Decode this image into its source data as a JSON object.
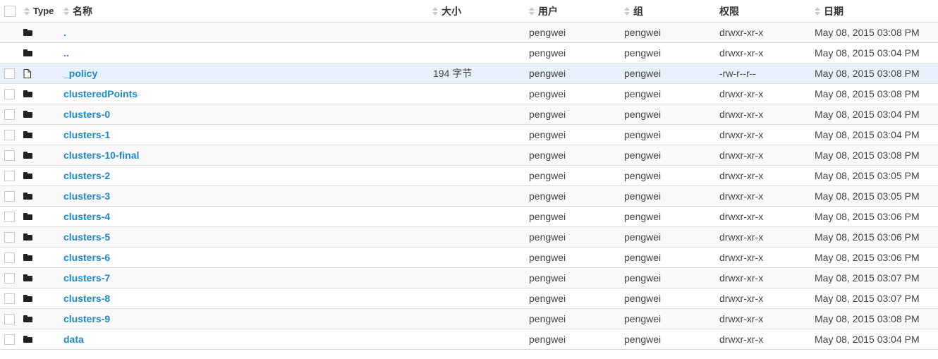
{
  "header": {
    "type": "Type",
    "name": "名称",
    "size": "大小",
    "user": "用户",
    "group": "组",
    "permission": "权限",
    "date": "日期"
  },
  "rows": [
    {
      "kind": "folder",
      "name": ".",
      "size": "",
      "user": "pengwei",
      "group": "pengwei",
      "permission": "drwxr-xr-x",
      "date": "May 08, 2015 03:08 PM",
      "has_checkbox": false
    },
    {
      "kind": "folder",
      "name": "..",
      "size": "",
      "user": "pengwei",
      "group": "pengwei",
      "permission": "drwxr-xr-x",
      "date": "May 08, 2015 03:04 PM",
      "has_checkbox": false
    },
    {
      "kind": "file",
      "name": "_policy",
      "size": "194 字节",
      "user": "pengwei",
      "group": "pengwei",
      "permission": "-rw-r--r--",
      "date": "May 08, 2015 03:08 PM",
      "has_checkbox": true
    },
    {
      "kind": "folder",
      "name": "clusteredPoints",
      "size": "",
      "user": "pengwei",
      "group": "pengwei",
      "permission": "drwxr-xr-x",
      "date": "May 08, 2015 03:08 PM",
      "has_checkbox": true
    },
    {
      "kind": "folder",
      "name": "clusters-0",
      "size": "",
      "user": "pengwei",
      "group": "pengwei",
      "permission": "drwxr-xr-x",
      "date": "May 08, 2015 03:04 PM",
      "has_checkbox": true
    },
    {
      "kind": "folder",
      "name": "clusters-1",
      "size": "",
      "user": "pengwei",
      "group": "pengwei",
      "permission": "drwxr-xr-x",
      "date": "May 08, 2015 03:04 PM",
      "has_checkbox": true
    },
    {
      "kind": "folder",
      "name": "clusters-10-final",
      "size": "",
      "user": "pengwei",
      "group": "pengwei",
      "permission": "drwxr-xr-x",
      "date": "May 08, 2015 03:08 PM",
      "has_checkbox": true
    },
    {
      "kind": "folder",
      "name": "clusters-2",
      "size": "",
      "user": "pengwei",
      "group": "pengwei",
      "permission": "drwxr-xr-x",
      "date": "May 08, 2015 03:05 PM",
      "has_checkbox": true
    },
    {
      "kind": "folder",
      "name": "clusters-3",
      "size": "",
      "user": "pengwei",
      "group": "pengwei",
      "permission": "drwxr-xr-x",
      "date": "May 08, 2015 03:05 PM",
      "has_checkbox": true
    },
    {
      "kind": "folder",
      "name": "clusters-4",
      "size": "",
      "user": "pengwei",
      "group": "pengwei",
      "permission": "drwxr-xr-x",
      "date": "May 08, 2015 03:06 PM",
      "has_checkbox": true
    },
    {
      "kind": "folder",
      "name": "clusters-5",
      "size": "",
      "user": "pengwei",
      "group": "pengwei",
      "permission": "drwxr-xr-x",
      "date": "May 08, 2015 03:06 PM",
      "has_checkbox": true
    },
    {
      "kind": "folder",
      "name": "clusters-6",
      "size": "",
      "user": "pengwei",
      "group": "pengwei",
      "permission": "drwxr-xr-x",
      "date": "May 08, 2015 03:06 PM",
      "has_checkbox": true
    },
    {
      "kind": "folder",
      "name": "clusters-7",
      "size": "",
      "user": "pengwei",
      "group": "pengwei",
      "permission": "drwxr-xr-x",
      "date": "May 08, 2015 03:07 PM",
      "has_checkbox": true
    },
    {
      "kind": "folder",
      "name": "clusters-8",
      "size": "",
      "user": "pengwei",
      "group": "pengwei",
      "permission": "drwxr-xr-x",
      "date": "May 08, 2015 03:07 PM",
      "has_checkbox": true
    },
    {
      "kind": "folder",
      "name": "clusters-9",
      "size": "",
      "user": "pengwei",
      "group": "pengwei",
      "permission": "drwxr-xr-x",
      "date": "May 08, 2015 03:08 PM",
      "has_checkbox": true
    },
    {
      "kind": "folder",
      "name": "data",
      "size": "",
      "user": "pengwei",
      "group": "pengwei",
      "permission": "drwxr-xr-x",
      "date": "May 08, 2015 03:04 PM",
      "has_checkbox": true
    }
  ],
  "highlighted_row": 2,
  "colors": {
    "link": "#1e88c7",
    "highlight_row": "#e8f1fb",
    "stripe_row": "#f9f9f9",
    "border": "#dddddd"
  },
  "icons": {
    "folder": "folder-icon",
    "file": "file-icon",
    "sort": "sort-icon"
  }
}
